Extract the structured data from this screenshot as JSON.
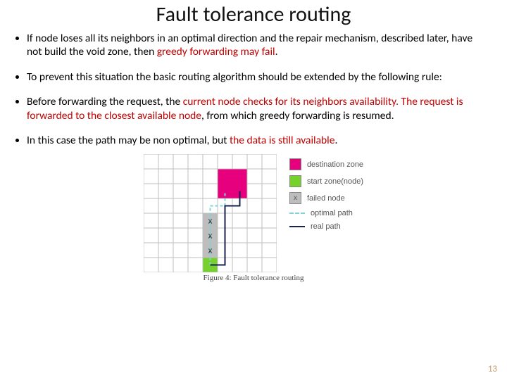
{
  "title": "Fault tolerance routing",
  "bullets": [
    {
      "pre": "If node loses all its neighbors in an optimal direction and the repair mechanism, described later, have not build the void zone, then ",
      "red": "greedy forwarding may fail",
      "post": "."
    },
    {
      "pre": "To prevent this situation the basic routing algorithm should be extended by the following rule:",
      "red": "",
      "post": ""
    },
    {
      "pre": "Before forwarding the request, the ",
      "red": "current node checks for its neighbors availability. The request is forwarded to the closest available node",
      "post": ", from which greedy forwarding is resumed."
    },
    {
      "pre": "In this case the path may be non optimal, but ",
      "red": "the data is still available",
      "post": "."
    }
  ],
  "legend": {
    "dest": "destination zone",
    "start": "start zone(node)",
    "failed": "failed node",
    "optimal": "optimal path",
    "real": "real path",
    "x": "x"
  },
  "colors": {
    "dest": "#e6007e",
    "start": "#76d12c",
    "failed_bg": "#bdbdbd",
    "grid": "#bfbfbf",
    "optimal": "#7fd4d4",
    "real": "#18214f"
  },
  "caption": "Figure 4: Fault tolerance routing",
  "pageNumber": "13",
  "chart_data": {
    "type": "diagram",
    "grid": {
      "cols": 9,
      "rows": 8
    },
    "destination_zone": {
      "col": 5,
      "row": 1,
      "span_cols": 2,
      "span_rows": 2
    },
    "start_zone": {
      "col": 4,
      "row": 7
    },
    "failed_nodes": [
      {
        "col": 4,
        "row": 4
      },
      {
        "col": 4,
        "row": 5
      },
      {
        "col": 4,
        "row": 6
      }
    ],
    "optimal_path_cells": [
      {
        "col": 4,
        "row": 7
      },
      {
        "col": 4,
        "row": 3
      },
      {
        "col": 5,
        "row": 3
      },
      {
        "col": 5,
        "row": 2
      }
    ],
    "real_path_cells": [
      {
        "col": 4,
        "row": 7
      },
      {
        "col": 5,
        "row": 7
      },
      {
        "col": 5,
        "row": 3
      },
      {
        "col": 6,
        "row": 3
      },
      {
        "col": 6,
        "row": 2
      }
    ],
    "legend_labels": [
      "destination zone",
      "start zone(node)",
      "failed node",
      "optimal path",
      "real path"
    ]
  }
}
